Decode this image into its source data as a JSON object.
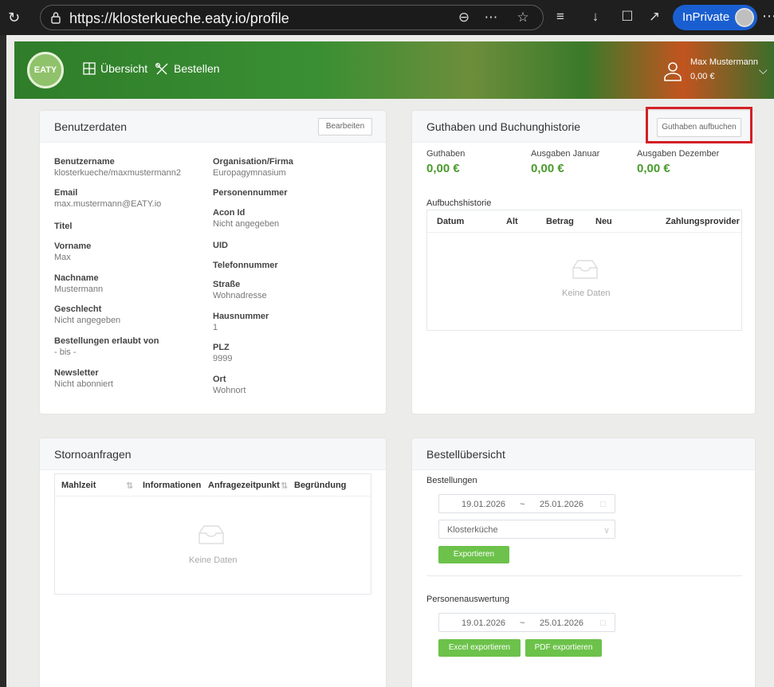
{
  "browser": {
    "url": "https://klosterkueche.eaty.io/profile",
    "inprivate_label": "InPrivate"
  },
  "header": {
    "logo_text": "EATY",
    "nav": [
      {
        "label": "Übersicht",
        "icon": "grid-icon"
      },
      {
        "label": "Bestellen",
        "icon": "cutlery-icon"
      }
    ],
    "user_name": "Max Mustermann",
    "user_balance": "0,00 €"
  },
  "benutzerdaten": {
    "title": "Benutzerdaten",
    "edit_label": "Bearbeiten",
    "left_fields": [
      {
        "label": "Benutzername",
        "value": "klosterkueche/maxmustermann2"
      },
      {
        "label": "Email",
        "value": "max.mustermann@EATY.io"
      },
      {
        "label": "Titel",
        "value": ""
      },
      {
        "label": "Vorname",
        "value": "Max"
      },
      {
        "label": "Nachname",
        "value": "Mustermann"
      },
      {
        "label": "Geschlecht",
        "value": "Nicht angegeben"
      },
      {
        "label": "Bestellungen erlaubt von",
        "value": "- bis -"
      },
      {
        "label": "Newsletter",
        "value": "Nicht abonniert"
      }
    ],
    "right_fields": [
      {
        "label": "Organisation/Firma",
        "value": "Europagymnasium"
      },
      {
        "label": "Personennummer",
        "value": ""
      },
      {
        "label": "Acon Id",
        "value": "Nicht angegeben"
      },
      {
        "label": "UID",
        "value": ""
      },
      {
        "label": "Telefonnummer",
        "value": ""
      },
      {
        "label": "Straße",
        "value": "Wohnadresse"
      },
      {
        "label": "Hausnummer",
        "value": "1"
      },
      {
        "label": "PLZ",
        "value": "9999"
      },
      {
        "label": "Ort",
        "value": "Wohnort"
      }
    ]
  },
  "guthaben": {
    "title": "Guthaben und Buchunghistorie",
    "topup_label": "Guthaben aufbuchen",
    "metrics": [
      {
        "label": "Guthaben",
        "value": "0,00 €"
      },
      {
        "label": "Ausgaben Januar",
        "value": "0,00 €"
      },
      {
        "label": "Ausgaben Dezember",
        "value": "0,00 €"
      }
    ],
    "history_label": "Aufbuchshistorie",
    "columns": [
      "Datum",
      "Alt",
      "Betrag",
      "Neu",
      "Zahlungsprovider"
    ],
    "empty_text": "Keine Daten"
  },
  "storno": {
    "title": "Stornoanfragen",
    "columns": [
      "Mahlzeit",
      "Informationen",
      "Anfragezeitpunkt",
      "Begründung"
    ],
    "empty_text": "Keine Daten"
  },
  "bestell": {
    "title": "Bestellübersicht",
    "orders_label": "Bestellungen",
    "date_from": "19.01.2026",
    "date_sep": "~",
    "date_to": "25.01.2026",
    "location": "Klosterküche",
    "export_label": "Exportieren",
    "persons_label": "Personenauswertung",
    "p_date_from": "19.01.2026",
    "p_date_to": "25.01.2026",
    "excel_label": "Excel exportieren",
    "pdf_label": "PDF exportieren"
  },
  "colors": {
    "accent_green": "#6cc24a",
    "highlight_red": "#d41f26",
    "inprivate_blue": "#1a5fd1"
  }
}
